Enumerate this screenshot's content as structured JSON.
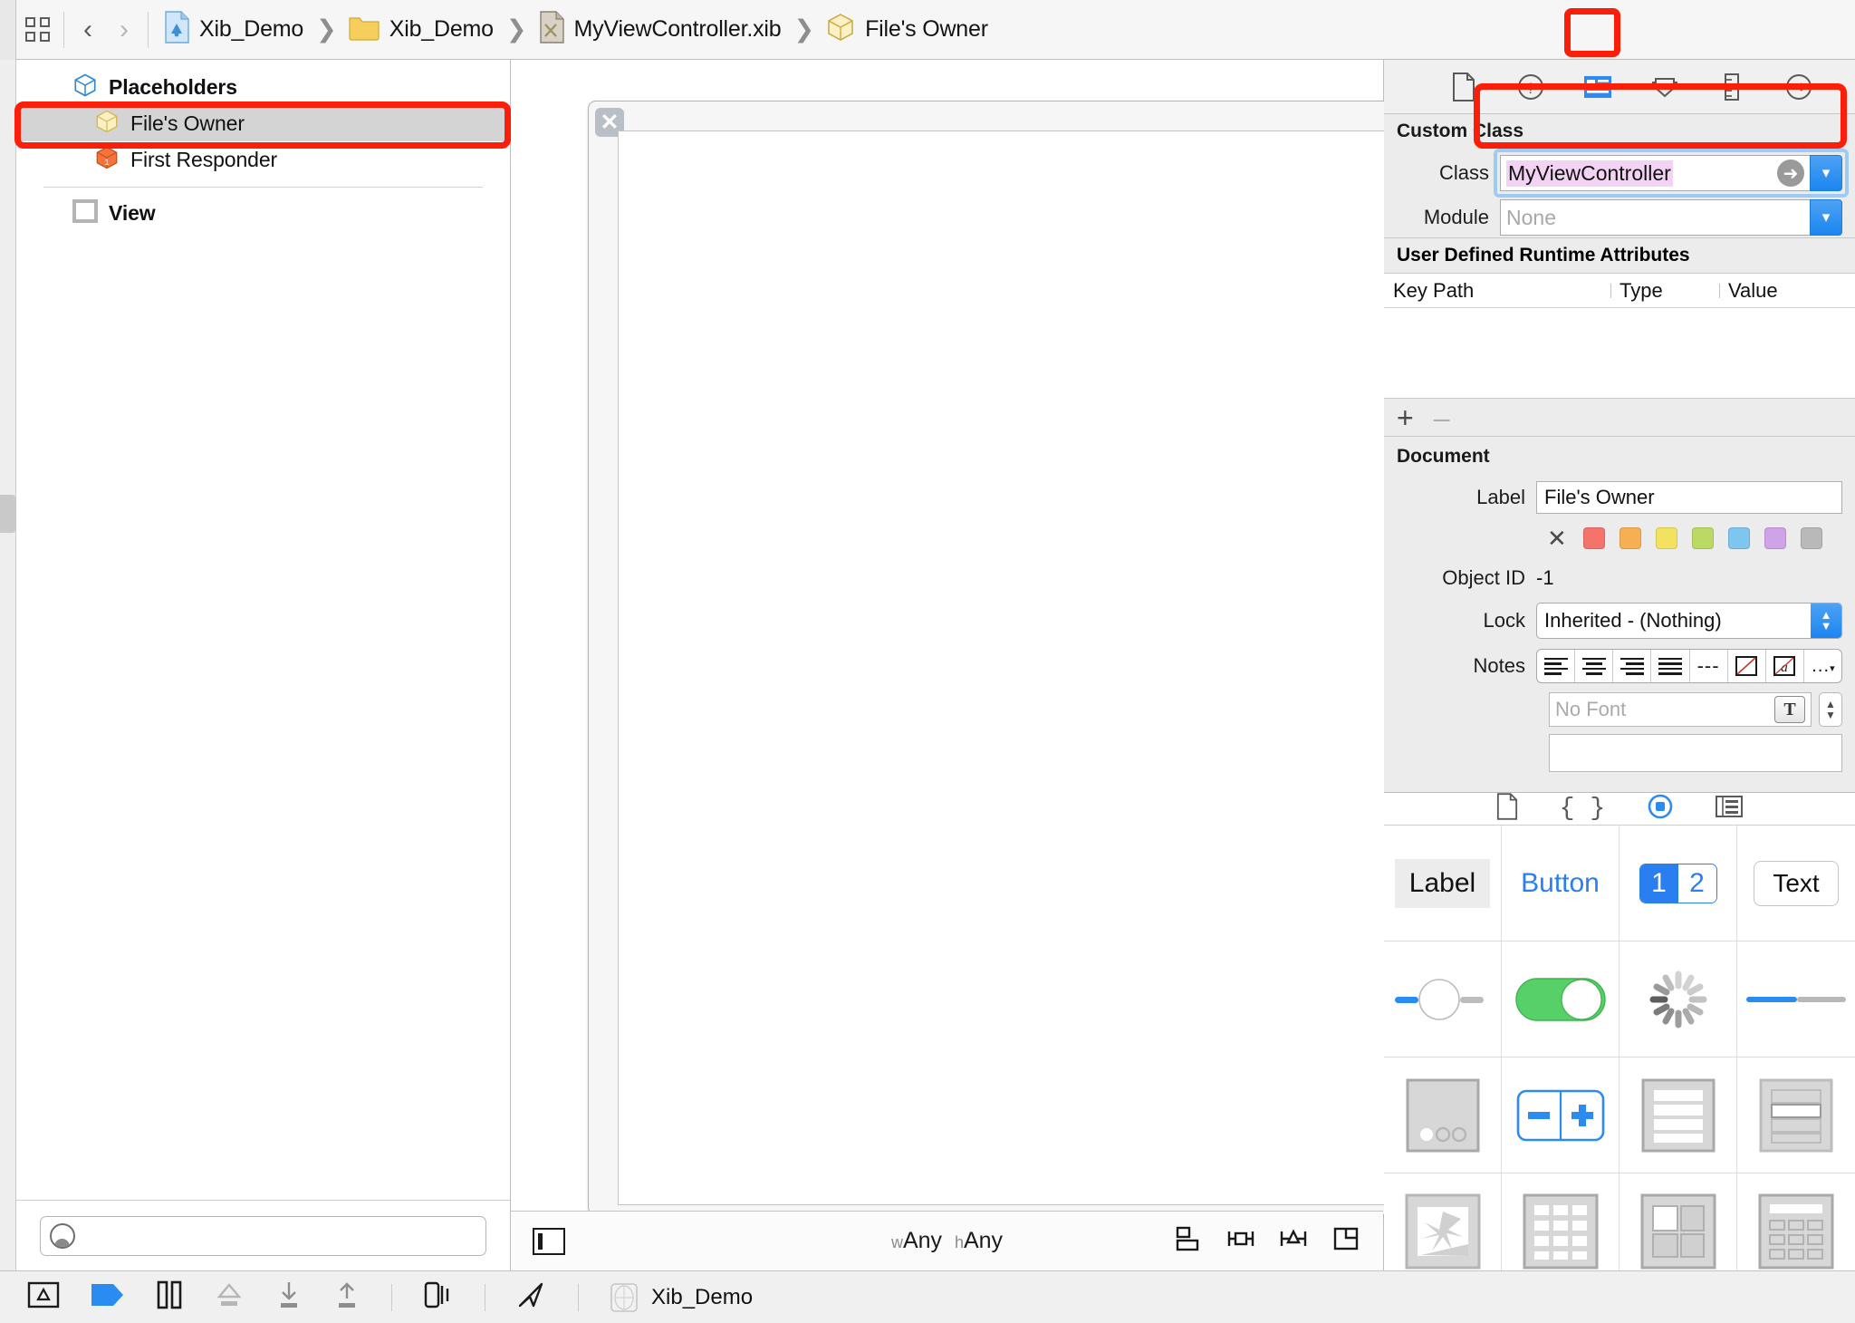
{
  "jumpbar": {
    "grid_icon": "grid-icon",
    "back_label": "‹",
    "forward_label": "›",
    "breadcrumbs": [
      {
        "label": "Xib_Demo",
        "icon": "xcode-project-icon"
      },
      {
        "label": "Xib_Demo",
        "icon": "folder-icon"
      },
      {
        "label": "MyViewController.xib",
        "icon": "xib-file-icon"
      },
      {
        "label": "File's Owner",
        "icon": "cube-icon"
      }
    ],
    "separator": "❯"
  },
  "outline": {
    "placeholders_header": "Placeholders",
    "items": [
      {
        "label": "File's Owner",
        "icon": "yellow-cube-icon",
        "selected": true
      },
      {
        "label": "First Responder",
        "icon": "orange-cube-icon",
        "selected": false
      }
    ],
    "objects": [
      {
        "label": "View",
        "icon": "view-square-icon"
      }
    ],
    "filter_placeholder": ""
  },
  "canvas": {
    "size_class_w_prefix": "w",
    "size_class_w": "Any",
    "size_class_h_prefix": "h",
    "size_class_h": "Any",
    "close_glyph": "✕",
    "bottom_icons": [
      "update-frames-icon",
      "embed-in-icon",
      "align-icon",
      "resolve-auto-layout-icon"
    ]
  },
  "inspector": {
    "tabs": [
      {
        "name": "file-inspector-tab",
        "icon": "document-icon",
        "selected": false
      },
      {
        "name": "quick-help-tab",
        "icon": "question-circle-icon",
        "selected": false
      },
      {
        "name": "identity-inspector-tab",
        "icon": "identity-card-icon",
        "selected": true
      },
      {
        "name": "attributes-inspector-tab",
        "icon": "slider-shield-icon",
        "selected": false
      },
      {
        "name": "size-inspector-tab",
        "icon": "ruler-icon",
        "selected": false
      },
      {
        "name": "connections-inspector-tab",
        "icon": "arrow-circle-icon",
        "selected": false
      }
    ],
    "custom_class": {
      "section_title": "Custom Class",
      "class_label": "Class",
      "class_value": "MyViewController",
      "module_label": "Module",
      "module_placeholder": "None"
    },
    "runtime_attributes": {
      "section_title": "User Defined Runtime Attributes",
      "columns": [
        "Key Path",
        "Type",
        "Value"
      ],
      "rows": [],
      "add_label": "+",
      "remove_label": "–"
    },
    "document": {
      "section_title": "Document",
      "label_label": "Label",
      "label_value": "File's Owner",
      "swatch_clear": "✕",
      "swatches": [
        "#f4736b",
        "#f6b053",
        "#f2e25f",
        "#bada64",
        "#7ec5f0",
        "#cfa3e8",
        "#b9b9b9"
      ],
      "object_id_label": "Object ID",
      "object_id_value": "-1",
      "lock_label": "Lock",
      "lock_value": "Inherited - (Nothing)",
      "notes_label": "Notes",
      "notes_font_placeholder": "No Font",
      "notes_value": "",
      "notes_buttons": [
        "align-left-icon",
        "align-center-icon",
        "align-right-icon",
        "align-justify-icon",
        "dashes-icon",
        "no-color-icon",
        "text-color-icon",
        "more-options-icon"
      ]
    }
  },
  "library": {
    "tabs": [
      {
        "name": "file-template-library-tab",
        "icon": "document-icon",
        "selected": false
      },
      {
        "name": "code-snippet-library-tab",
        "icon": "braces-icon",
        "selected": false
      },
      {
        "name": "object-library-tab",
        "icon": "circle-target-icon",
        "selected": true
      },
      {
        "name": "media-library-tab",
        "icon": "media-icon",
        "selected": false
      }
    ],
    "objects": [
      {
        "name": "label-object",
        "display": "Label"
      },
      {
        "name": "button-object",
        "display": "Button"
      },
      {
        "name": "segmented-control-object",
        "display": "1 2",
        "seg1": "1",
        "seg2": "2"
      },
      {
        "name": "text-field-object",
        "display": "Text"
      },
      {
        "name": "slider-object",
        "display": ""
      },
      {
        "name": "switch-object",
        "display": ""
      },
      {
        "name": "activity-indicator-object",
        "display": ""
      },
      {
        "name": "progress-view-object",
        "display": ""
      },
      {
        "name": "page-control-object",
        "display": ""
      },
      {
        "name": "stepper-object",
        "display": ""
      },
      {
        "name": "table-view-object",
        "display": ""
      },
      {
        "name": "table-view-cell-object",
        "display": ""
      },
      {
        "name": "image-view-object",
        "display": ""
      },
      {
        "name": "collection-view-object",
        "display": ""
      },
      {
        "name": "collection-view-cell-object",
        "display": ""
      },
      {
        "name": "collection-reusable-view-object",
        "display": ""
      }
    ],
    "filter_placeholder": ""
  },
  "bottombar": {
    "buttons": [
      "breakpoint-icon",
      "continue-icon",
      "pause-icon",
      "step-over-icon",
      "step-into-icon",
      "step-out-icon"
    ],
    "view-debug-icon": "view-debug-icon",
    "location-icon": "simulate-location-icon",
    "scheme_label": "Xib_Demo"
  },
  "annotations": {
    "boxes": [
      {
        "name": "file-owner-row-highlight"
      },
      {
        "name": "identity-inspector-tab-highlight"
      },
      {
        "name": "custom-class-field-highlight"
      }
    ],
    "color": "#fb1e09"
  }
}
